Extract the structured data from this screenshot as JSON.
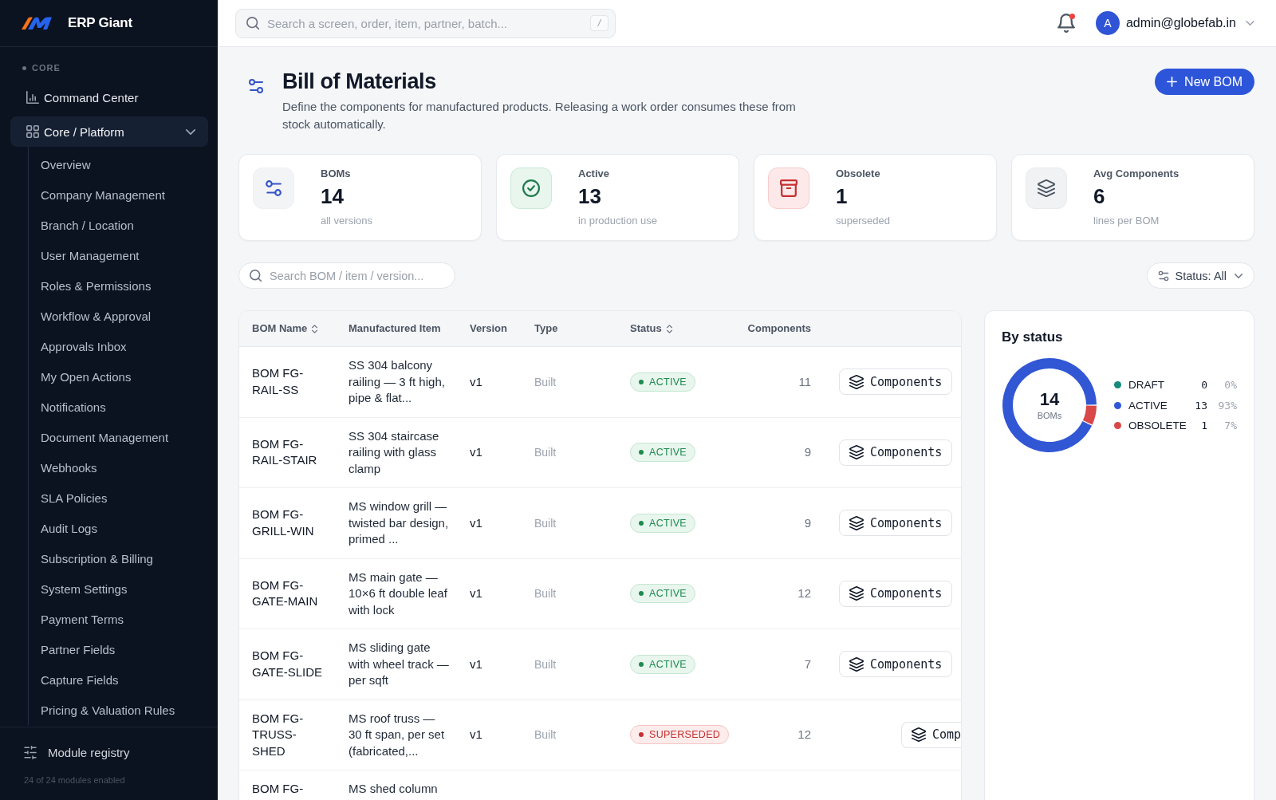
{
  "sidebar": {
    "brand": "ERP Giant",
    "section": "CORE",
    "items": [
      {
        "label": "Command Center",
        "kind": "link",
        "selected": false
      },
      {
        "label": "Core / Platform",
        "kind": "group",
        "selected": true,
        "expanded": true,
        "children": [
          {
            "label": "Overview",
            "selected": false
          },
          {
            "label": "Company Management",
            "selected": false
          },
          {
            "label": "Branch / Location",
            "selected": false
          },
          {
            "label": "User Management",
            "selected": false
          },
          {
            "label": "Roles & Permissions",
            "selected": false
          },
          {
            "label": "Workflow & Approval",
            "selected": false
          },
          {
            "label": "Approvals Inbox",
            "selected": false
          },
          {
            "label": "My Open Actions",
            "selected": false
          },
          {
            "label": "Notifications",
            "selected": false
          },
          {
            "label": "Document Management",
            "selected": false
          },
          {
            "label": "Webhooks",
            "selected": false
          },
          {
            "label": "SLA Policies",
            "selected": false
          },
          {
            "label": "Audit Logs",
            "selected": false
          },
          {
            "label": "Subscription & Billing",
            "selected": false
          },
          {
            "label": "System Settings",
            "selected": false
          },
          {
            "label": "Payment Terms",
            "selected": false
          },
          {
            "label": "Partner Fields",
            "selected": false
          },
          {
            "label": "Capture Fields",
            "selected": false
          },
          {
            "label": "Pricing & Valuation Rules",
            "selected": false
          }
        ]
      }
    ],
    "footer": {
      "label": "Module registry",
      "note": "24 of 24 modules enabled"
    }
  },
  "topbar": {
    "search": {
      "placeholder": "Search a screen, order, item, partner, batch...",
      "shortcut": "/"
    },
    "notifications": {
      "unread": true
    },
    "user": {
      "initial": "A",
      "email": "admin@globefab.in"
    }
  },
  "page": {
    "title": "Bill of Materials",
    "description": "Define the components for manufactured products. Releasing a work order consumes these from stock automatically.",
    "new_button": "New BOM"
  },
  "stats": [
    {
      "kind": "total",
      "label": "BOMs",
      "value": "14",
      "caption": "all versions"
    },
    {
      "kind": "active",
      "label": "Active",
      "value": "13",
      "caption": "in production use"
    },
    {
      "kind": "obsolete",
      "label": "Obsolete",
      "value": "1",
      "caption": "superseded"
    },
    {
      "kind": "average",
      "label": "Avg Components",
      "value": "6",
      "caption": "lines per BOM"
    }
  ],
  "filters": {
    "search": {
      "placeholder": "Search BOM / item / version..."
    },
    "status": "Status: All"
  },
  "table": {
    "columns": [
      {
        "label": "BOM Name",
        "sortable": true
      },
      {
        "label": "Manufactured Item",
        "sortable": false
      },
      {
        "label": "Version",
        "sortable": false
      },
      {
        "label": "Type",
        "sortable": false
      },
      {
        "label": "Status",
        "sortable": true
      },
      {
        "label": "Components",
        "sortable": false
      }
    ],
    "rows": [
      {
        "name": "BOM FG-RAIL-SS",
        "item": "SS 304 balcony railing — 3 ft high, pipe & flat...",
        "version": "v1",
        "type": "Built",
        "status": {
          "label": "ACTIVE",
          "kind": "active"
        },
        "components": "11",
        "action": {
          "label": "Components",
          "clipped": false
        }
      },
      {
        "name": "BOM FG-RAIL-STAIR",
        "item": "SS 304 staircase railing with glass clamp",
        "version": "v1",
        "type": "Built",
        "status": {
          "label": "ACTIVE",
          "kind": "active"
        },
        "components": "9",
        "action": {
          "label": "Components",
          "clipped": false
        }
      },
      {
        "name": "BOM FG-GRILL-WIN",
        "item": "MS window grill — twisted bar design, primed ...",
        "version": "v1",
        "type": "Built",
        "status": {
          "label": "ACTIVE",
          "kind": "active"
        },
        "components": "9",
        "action": {
          "label": "Components",
          "clipped": false
        }
      },
      {
        "name": "BOM FG-GATE-MAIN",
        "item": "MS main gate — 10×6 ft double leaf with lock",
        "version": "v1",
        "type": "Built",
        "status": {
          "label": "ACTIVE",
          "kind": "active"
        },
        "components": "12",
        "action": {
          "label": "Components",
          "clipped": false
        }
      },
      {
        "name": "BOM FG-GATE-SLIDE",
        "item": "MS sliding gate with wheel track — per sqft",
        "version": "v1",
        "type": "Built",
        "status": {
          "label": "ACTIVE",
          "kind": "active"
        },
        "components": "7",
        "action": {
          "label": "Components",
          "clipped": false
        }
      },
      {
        "name": "BOM FG-TRUSS-SHED",
        "item": "MS roof truss — 30 ft span, per set (fabricated,...",
        "version": "v1",
        "type": "Built",
        "status": {
          "label": "SUPERSEDED",
          "kind": "superseded"
        },
        "components": "12",
        "action": {
          "label": "Comp",
          "clipped": true
        }
      },
      {
        "name": "BOM FG-",
        "item": "MS shed column"
      }
    ]
  },
  "status_panel": {
    "title": "By status",
    "total": "14",
    "total_label": "BOMs",
    "chart_data": {
      "type": "donut",
      "categories": [
        "DRAFT",
        "ACTIVE",
        "OBSOLETE"
      ],
      "values": [
        0,
        93,
        7
      ]
    },
    "legend": [
      {
        "count": "0",
        "share": "0%",
        "color": "#168a7c"
      },
      {
        "count": "13",
        "share": "93%",
        "color": "#3157d4"
      },
      {
        "count": "1",
        "share": "7%",
        "color": "#d94848"
      }
    ]
  }
}
